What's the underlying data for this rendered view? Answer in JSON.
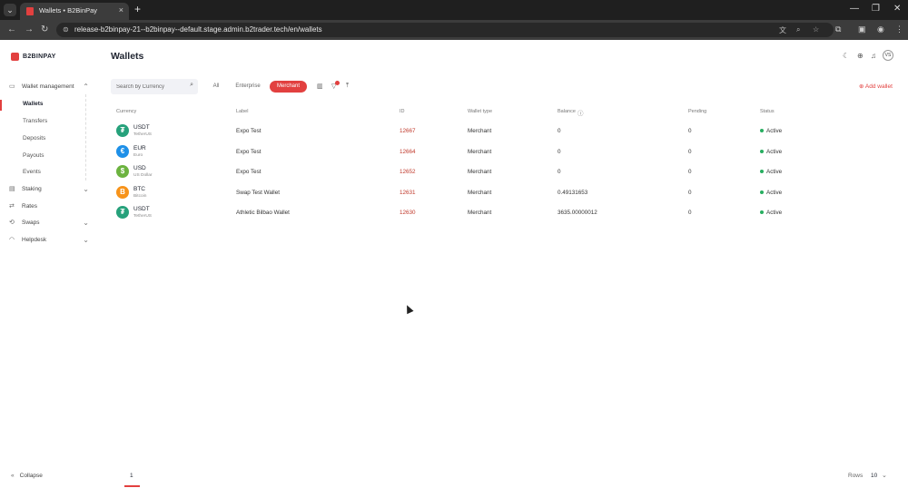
{
  "browser": {
    "tab_title": "Wallets • B2BinPay",
    "url": "release-b2binpay-21--b2binpay--default.stage.admin.b2trader.tech/en/wallets"
  },
  "app": {
    "logo_text": "B2BINPAY",
    "brand_color": "#e2403f",
    "page_title": "Wallets",
    "avatar_initials": "VS"
  },
  "sidebar": {
    "items": [
      {
        "label": "Wallet management",
        "icon": "wallet-icon",
        "expanded": true
      },
      {
        "label": "Staking",
        "icon": "staking-icon",
        "expanded": false
      },
      {
        "label": "Rates",
        "icon": "rates-icon"
      },
      {
        "label": "Swaps",
        "icon": "swap-icon",
        "expanded": false
      },
      {
        "label": "Helpdesk",
        "icon": "headset-icon",
        "expanded": false
      }
    ],
    "subitems": [
      "Wallets",
      "Transfers",
      "Deposits",
      "Payouts",
      "Events"
    ],
    "active_subitem": "Wallets",
    "collapse_label": "Collapse"
  },
  "toolbar": {
    "search_placeholder": "Search by Currency",
    "filters": [
      "All",
      "Enterprise",
      "Merchant"
    ],
    "active_filter": "Merchant",
    "add_wallet_label": "Add wallet"
  },
  "table": {
    "headers": [
      "Currency",
      "Label",
      "ID",
      "Wallet type",
      "Balance",
      "Pending",
      "Status"
    ],
    "rows": [
      {
        "code": "USDT",
        "name": "TetherUS",
        "icon_color": "#26a17b",
        "symbol": "₮",
        "label": "Expo Test",
        "id": "12667",
        "type": "Merchant",
        "balance": "0",
        "pending": "0",
        "status": "Active"
      },
      {
        "code": "EUR",
        "name": "Euro",
        "icon_color": "#1e90e8",
        "symbol": "€",
        "label": "Expo Test",
        "id": "12664",
        "type": "Merchant",
        "balance": "0",
        "pending": "0",
        "status": "Active"
      },
      {
        "code": "USD",
        "name": "US Dollar",
        "icon_color": "#6cb33f",
        "symbol": "$",
        "label": "Expo Test",
        "id": "12652",
        "type": "Merchant",
        "balance": "0",
        "pending": "0",
        "status": "Active"
      },
      {
        "code": "BTC",
        "name": "Bitcoin",
        "icon_color": "#f7931a",
        "symbol": "B",
        "label": "Swap Test Wallet",
        "id": "12631",
        "type": "Merchant",
        "balance": "0.49131653",
        "pending": "0",
        "status": "Active"
      },
      {
        "code": "USDT",
        "name": "TetherUS",
        "icon_color": "#26a17b",
        "symbol": "₮",
        "label": "Athletic Bilbao Wallet",
        "id": "12630",
        "type": "Merchant",
        "balance": "3635.00000012",
        "pending": "0",
        "status": "Active"
      }
    ]
  },
  "pagination": {
    "current_page": "1",
    "rows_label": "Rows",
    "rows_value": "10"
  }
}
